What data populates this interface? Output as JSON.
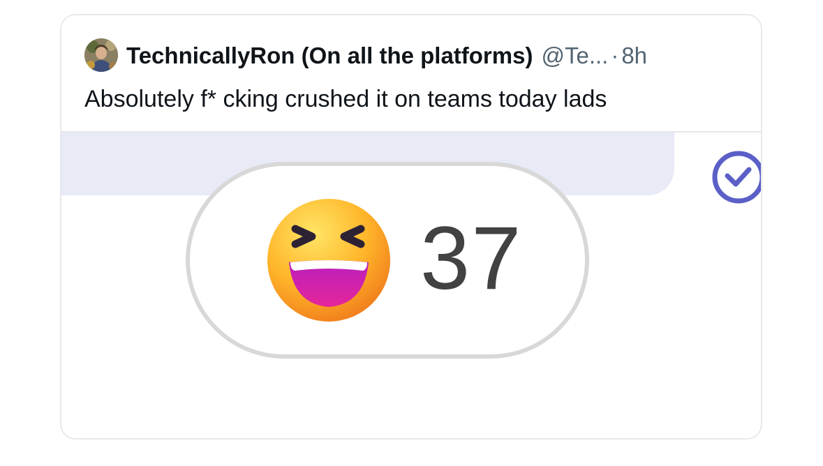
{
  "tweet": {
    "author_name": "TechnicallyRon (On all the platforms)",
    "handle": "@Te...",
    "separator": "·",
    "time": "8h",
    "text": "Absolutely f* cking crushed it on teams today lads"
  },
  "teams_reaction": {
    "emoji_icon": "laughing-squinting-face-icon",
    "count": "37"
  },
  "icons": {
    "avatar": "profile-photo",
    "check": "check-circle-icon"
  },
  "colors": {
    "text_primary": "#0f1419",
    "text_secondary": "#536471",
    "bubble_background": "#e8eaf6",
    "check_color": "#5b5fc7",
    "pill_border": "#d8d8d8",
    "count_color": "#424242"
  }
}
